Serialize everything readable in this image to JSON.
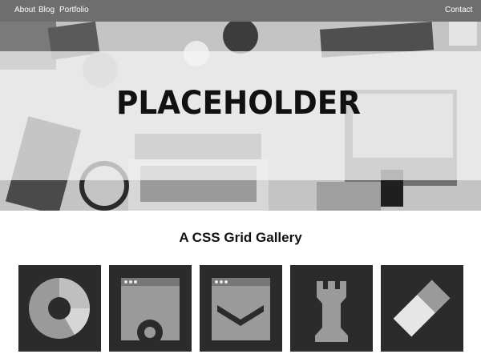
{
  "nav": {
    "left": [
      "About",
      "Blog",
      "Portfolio"
    ],
    "right": "Contact"
  },
  "hero": {
    "logo_text": "PLACEHOLDER"
  },
  "gallery": {
    "title": "A CSS Grid Gallery",
    "items": [
      {
        "icon": "pie-chart-icon"
      },
      {
        "icon": "browser-settings-icon"
      },
      {
        "icon": "browser-chevron-icon"
      },
      {
        "icon": "chess-rook-icon"
      },
      {
        "icon": "eraser-icon"
      }
    ]
  },
  "colors": {
    "nav_bg": "#6e6e6e",
    "tile_bg": "#2b2b2b",
    "icon_light": "#9a9a9a",
    "icon_lighter": "#e6e6e6"
  }
}
